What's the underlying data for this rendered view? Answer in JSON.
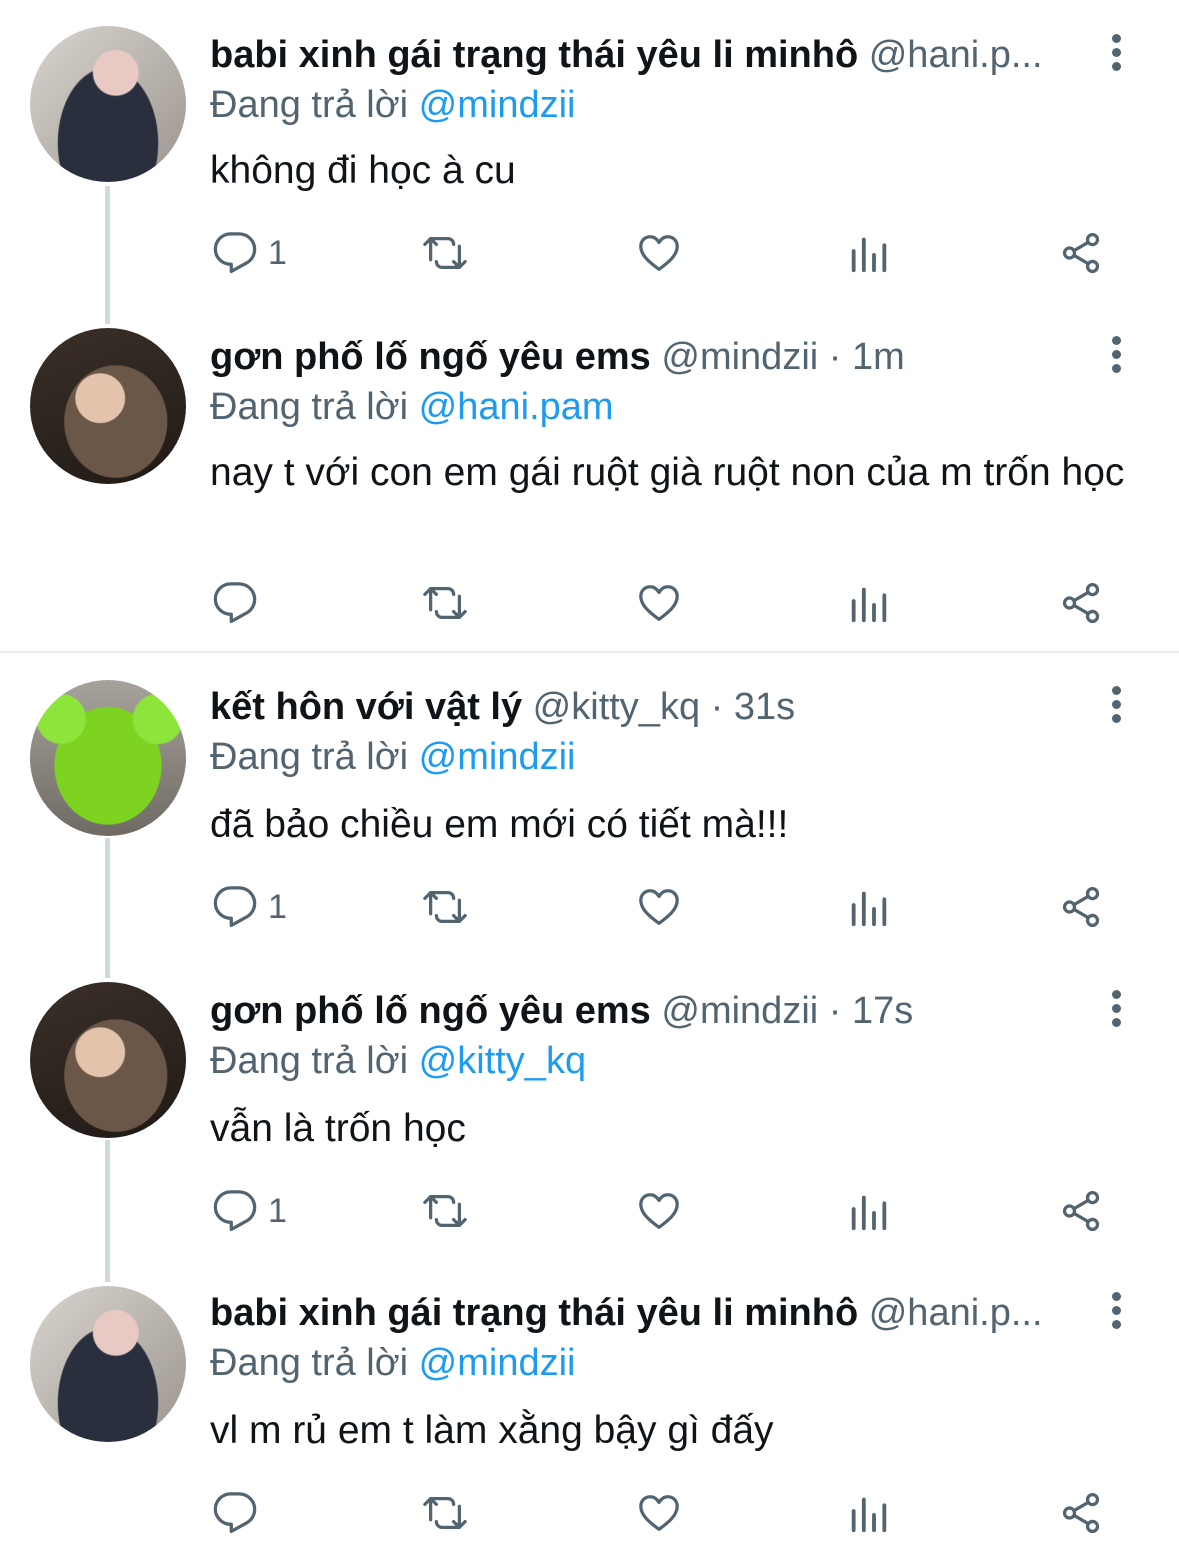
{
  "tweets": [
    {
      "name": "babi xinh gái trạng thái yêu li minhô",
      "handle": "@hani.p...",
      "time": "",
      "reply_prefix": "Đang trả lời ",
      "reply_to": "@mindzii",
      "text": "không đi học à cu",
      "reply_count": "1",
      "avatar": "hani"
    },
    {
      "name": "gơn phố lố ngố yêu ems",
      "handle": "@mindzii",
      "time": "· 1m",
      "reply_prefix": "Đang trả lời ",
      "reply_to": "@hani.pam",
      "text": "nay t với con em gái ruột già ruột non của m trốn học",
      "reply_count": "",
      "avatar": "mindzii"
    },
    {
      "name": "kết hôn với vật lý",
      "handle": "@kitty_kq",
      "time": "· 31s",
      "reply_prefix": "Đang trả lời ",
      "reply_to": "@mindzii",
      "text": "đã bảo chiều em mới có tiết mà!!!",
      "reply_count": "1",
      "avatar": "kitty"
    },
    {
      "name": "gơn phố lố ngố yêu ems",
      "handle": "@mindzii",
      "time": "· 17s",
      "reply_prefix": "Đang trả lời ",
      "reply_to": "@kitty_kq",
      "text": "vẫn là trốn học",
      "reply_count": "1",
      "avatar": "mindzii"
    },
    {
      "name": "babi xinh gái trạng thái yêu li minhô",
      "handle": "@hani.p...",
      "time": "",
      "reply_prefix": "Đang trả lời ",
      "reply_to": "@mindzii",
      "text": "vl m rủ em t làm xằng bậy gì đấy",
      "reply_count": "",
      "avatar": "hani"
    }
  ],
  "icons": {
    "reply": "reply-icon",
    "retweet": "retweet-icon",
    "like": "heart-icon",
    "views": "views-icon",
    "share": "share-icon",
    "more": "more-vertical-icon"
  },
  "colors": {
    "accent": "#1d9bf0",
    "secondary_text": "#536471",
    "thread_line": "#cfd9de"
  }
}
